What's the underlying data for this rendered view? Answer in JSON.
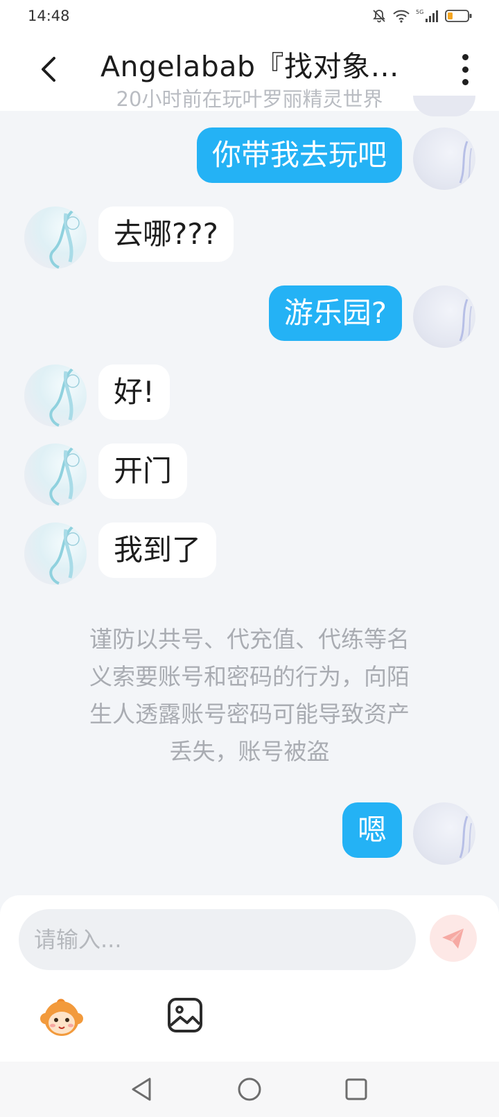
{
  "status_bar": {
    "time": "14:48",
    "icons": [
      "bell-muted-icon",
      "wifi-icon",
      "signal-5g-icon",
      "battery-low-icon"
    ],
    "network_label": "5G"
  },
  "header": {
    "title": "Angelabab『找对象…",
    "subtitle": "20小时前在玩叶罗丽精灵世界",
    "back_icon": "chevron-left-icon",
    "more_icon": "more-vertical-icon"
  },
  "messages": [
    {
      "sender": "me",
      "text": "你带我去玩吧"
    },
    {
      "sender": "them",
      "text": "去哪???"
    },
    {
      "sender": "me",
      "text": "游乐园?"
    },
    {
      "sender": "them",
      "text": "好!"
    },
    {
      "sender": "them",
      "text": "开门"
    },
    {
      "sender": "them",
      "text": "我到了"
    },
    {
      "sender": "me",
      "text": "嗯"
    }
  ],
  "warning": {
    "lines": [
      "谨防以共号、代充值、代练等名",
      "义索要账号和密码的行为，向陌",
      "生人透露账号密码可能导致资产",
      "丢失，账号被盗"
    ]
  },
  "composer": {
    "placeholder": "请输入...",
    "value": "",
    "send_icon": "send-plane-icon",
    "tools": [
      "emoji-monkey-icon",
      "image-icon"
    ]
  },
  "nav_bar": {
    "buttons": [
      "back-triangle-icon",
      "home-circle-icon",
      "recents-square-icon"
    ]
  },
  "colors": {
    "my_bubble": "#24b2f5",
    "their_bubble": "#ffffff",
    "background": "#f3f5f8",
    "warning_text": "#a9acb2",
    "send_button": "#fde8e6",
    "send_icon": "#f6a9a3"
  }
}
